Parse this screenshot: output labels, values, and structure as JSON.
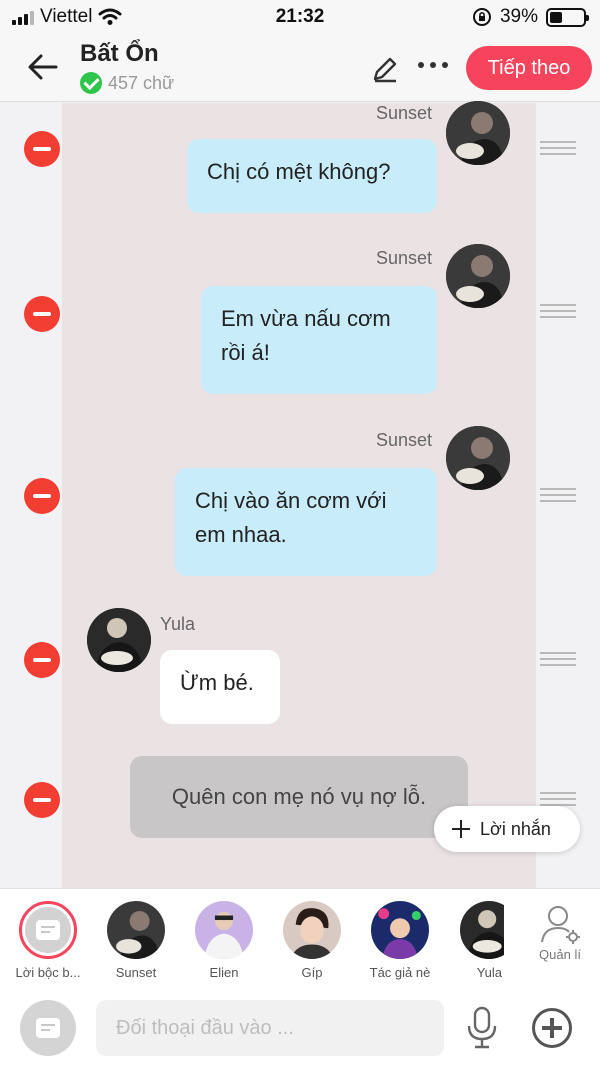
{
  "status_bar": {
    "carrier": "Viettel",
    "time": "21:32",
    "battery_text": "39%",
    "battery_level": 0.39
  },
  "header": {
    "title": "Bất Ổn",
    "word_count": "457 chữ",
    "next_label": "Tiếp theo"
  },
  "messages": [
    {
      "speaker": "Sunset",
      "text": "Chị có mệt không?"
    },
    {
      "speaker": "Sunset",
      "text": "Em vừa nấu cơm rồi á!"
    },
    {
      "speaker": "Sunset",
      "text": "Chị vào ăn cơm với em nhaa."
    },
    {
      "speaker": "Yula",
      "text": "Ừm bé."
    },
    {
      "speaker": "",
      "text": "Quên con mẹ nó vụ nợ lỗ."
    }
  ],
  "add_message_label": "Lời nhắn",
  "characters": [
    {
      "name": "Lời bộc b..."
    },
    {
      "name": "Sunset"
    },
    {
      "name": "Elien"
    },
    {
      "name": "Gíp"
    },
    {
      "name": "Tác giả nè"
    },
    {
      "name": "Yula"
    }
  ],
  "manage_label": "Quản lí",
  "input": {
    "placeholder": "Đối thoại đầu vào ..."
  },
  "colors": {
    "accent": "#f5445c",
    "bubble_right": "#c8ecfa",
    "remove": "#f23d32",
    "chat_bg": "#ebe2e4"
  }
}
